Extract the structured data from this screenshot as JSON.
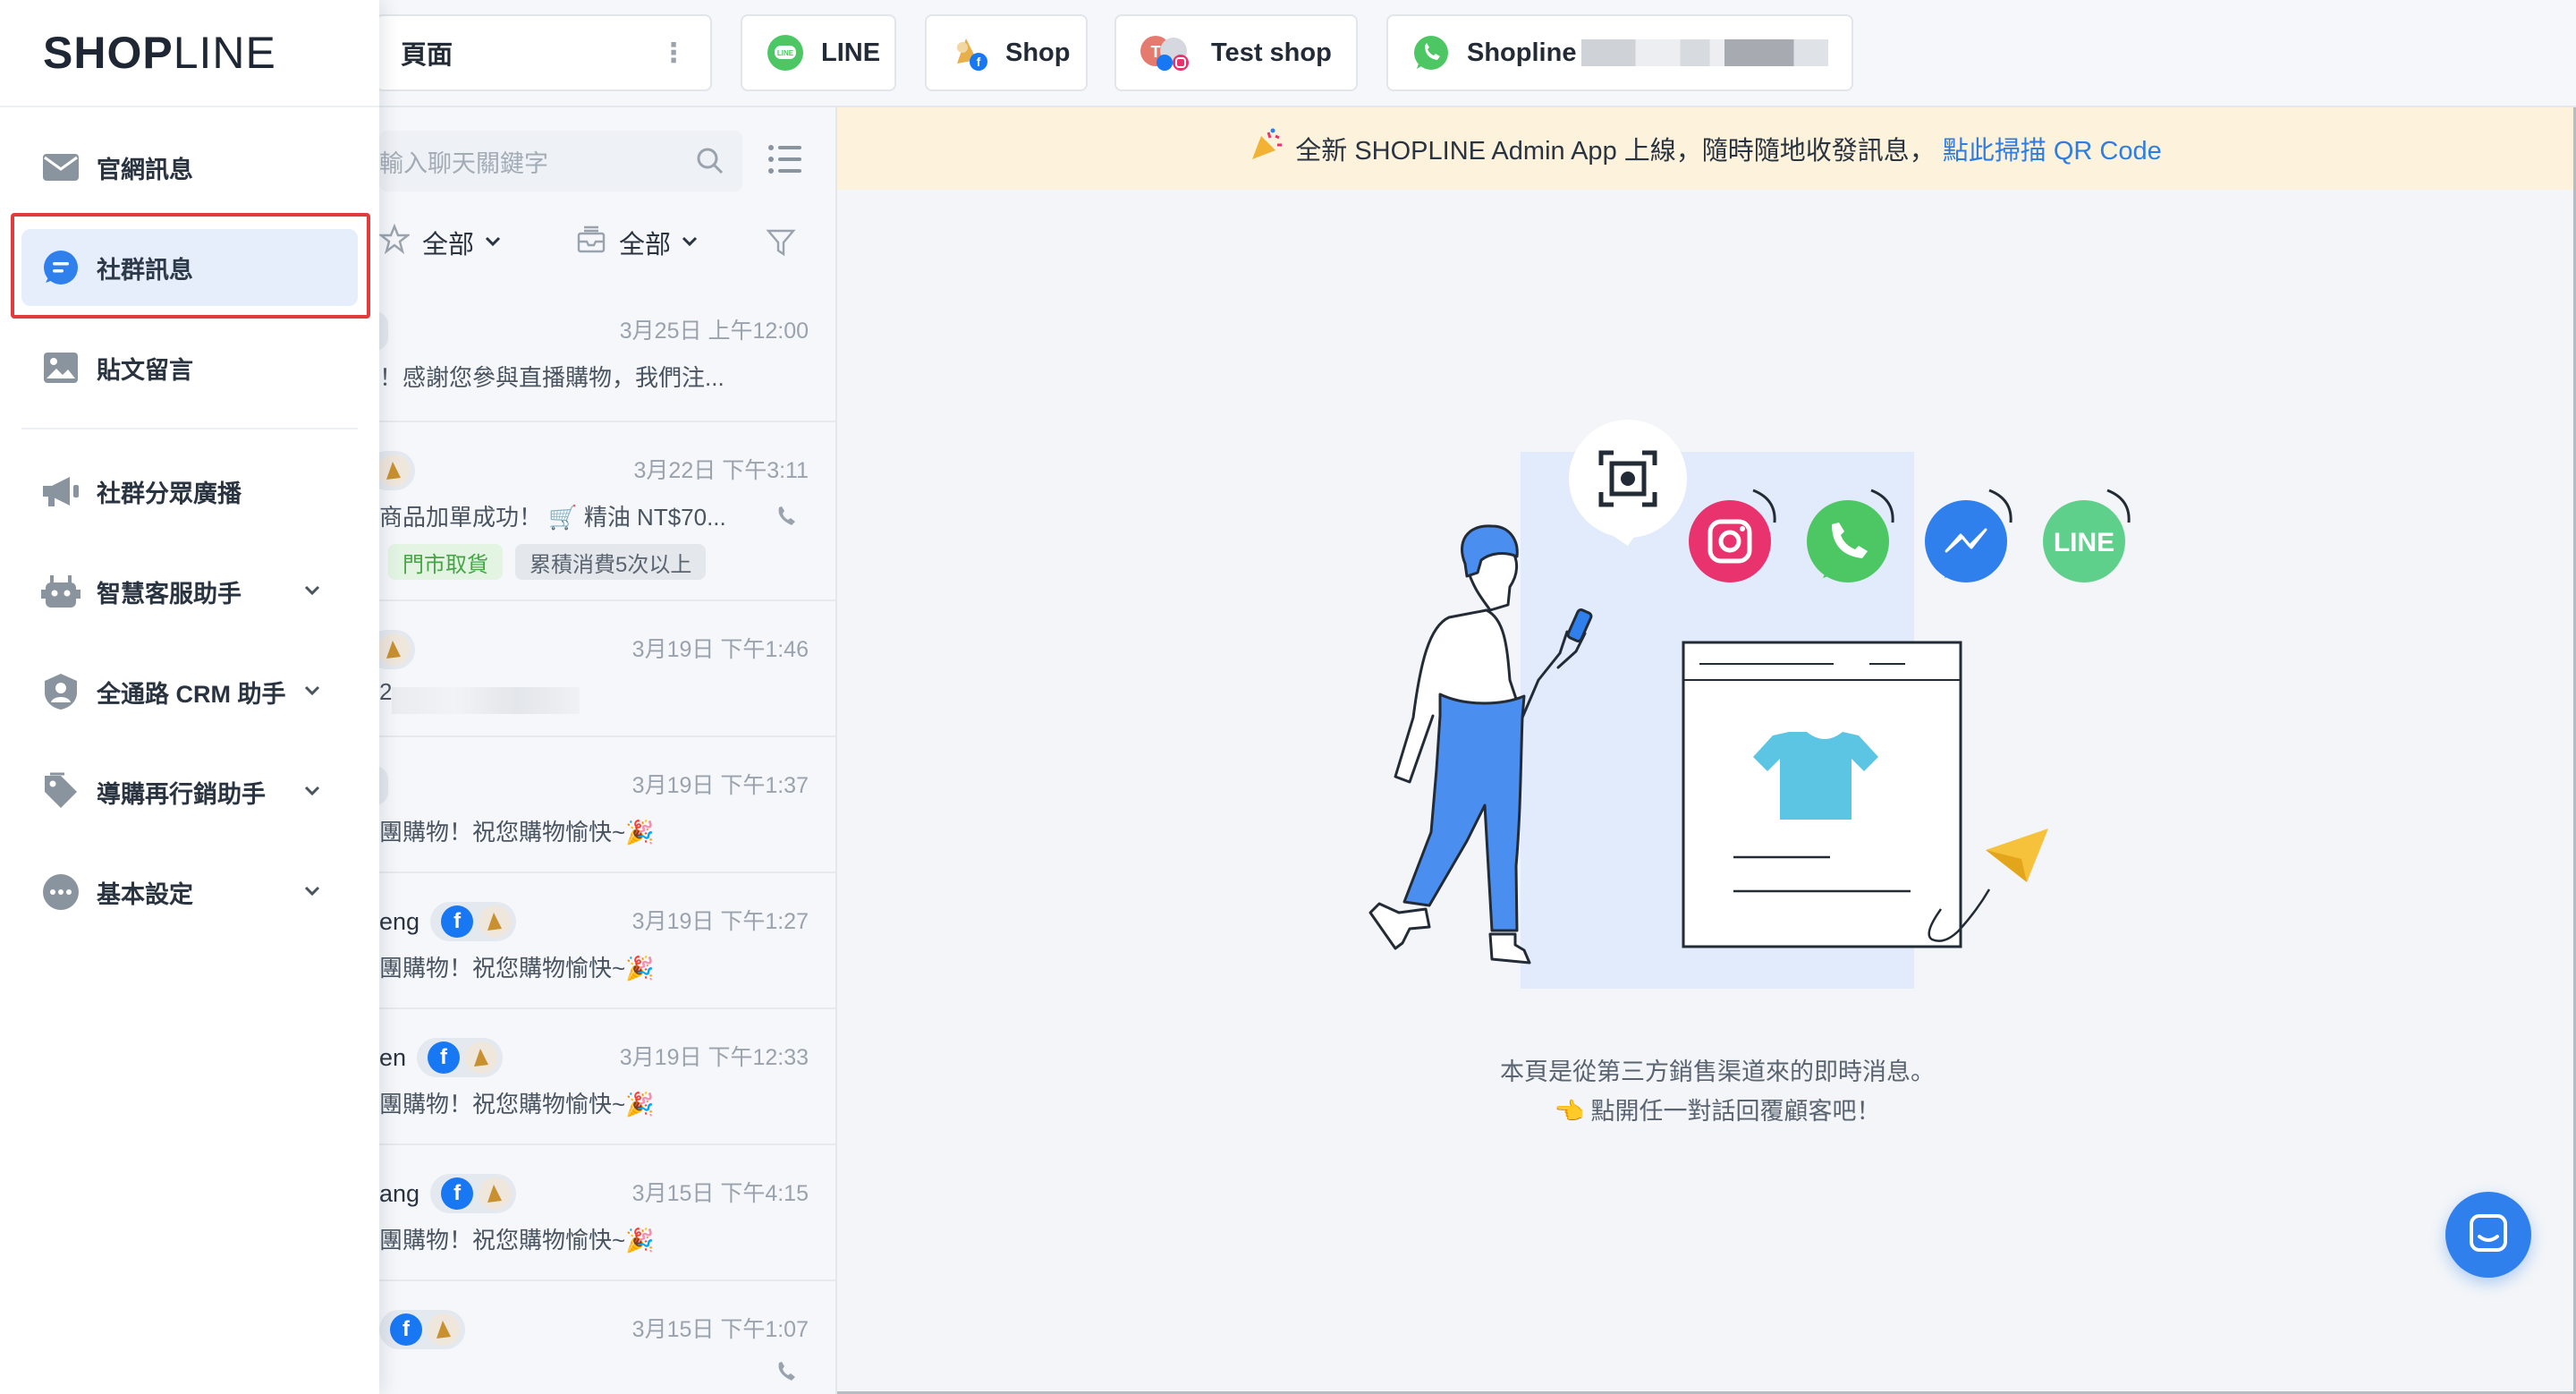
{
  "brand": {
    "logo_bold": "SHOP",
    "logo_thin": "LINE"
  },
  "tabs": {
    "page_tab": "頁面",
    "items": [
      {
        "label": "LINE",
        "icon": "line-icon"
      },
      {
        "label": "Shop",
        "icon": "facebook-shop-icon"
      },
      {
        "label": "Test shop",
        "icon": "instagram-shop-icon"
      },
      {
        "label": "Shopline",
        "icon": "whatsapp-icon"
      }
    ]
  },
  "sidebar": {
    "items": [
      {
        "label": "官網訊息",
        "icon": "mail-icon"
      },
      {
        "label": "社群訊息",
        "icon": "chat-bubble-icon",
        "active": true
      },
      {
        "label": "貼文留言",
        "icon": "image-icon"
      },
      {
        "label": "社群分眾廣播",
        "icon": "megaphone-icon"
      },
      {
        "label": "智慧客服助手",
        "icon": "robot-icon"
      },
      {
        "label": "全通路 CRM 助手",
        "icon": "crm-user-icon"
      },
      {
        "label": "導購再行銷助手",
        "icon": "tag-icon"
      },
      {
        "label": "基本設定",
        "icon": "more-dots-icon"
      }
    ]
  },
  "chat_list": {
    "search_placeholder": "輸入聊天關鍵字",
    "filter_star_label": "全部",
    "filter_inbox_label": "全部",
    "rows": [
      {
        "name": "",
        "time": "3月25日 上午12:00",
        "preview": "！感謝您參與直播購物，我們注..."
      },
      {
        "name": "",
        "time": "3月22日 下午3:11",
        "preview": "商品加單成功！ 🛒 精油 NT$70...",
        "tags": [
          "門市取貨",
          "累積消費5次以上"
        ]
      },
      {
        "name": "",
        "time": "3月19日 下午1:46",
        "preview": "2"
      },
      {
        "name": "",
        "time": "3月19日 下午1:37",
        "preview": "團購物！祝您購物愉快~🎉"
      },
      {
        "name": "eng",
        "time": "3月19日 下午1:27",
        "preview": "團購物！祝您購物愉快~🎉"
      },
      {
        "name": "en",
        "time": "3月19日 下午12:33",
        "preview": "團購物！祝您購物愉快~🎉"
      },
      {
        "name": "ang",
        "time": "3月15日 下午4:15",
        "preview": "團購物！祝您購物愉快~🎉"
      },
      {
        "name": "",
        "time": "3月15日 下午1:07",
        "preview": ""
      }
    ]
  },
  "banner": {
    "text": "全新 SHOPLINE Admin App 上線，隨時隨地收發訊息，",
    "link": "點此掃描 QR Code"
  },
  "empty_state": {
    "line1": "本頁是從第三方銷售渠道來的即時消息。",
    "line2": "👈 點開任一對話回覆顧客吧！"
  },
  "colors": {
    "accent": "#2f80ed",
    "highlight": "#e23b3b",
    "line_green": "#4cc764",
    "instagram": "#e8336e",
    "messenger": "#2f80ed"
  }
}
